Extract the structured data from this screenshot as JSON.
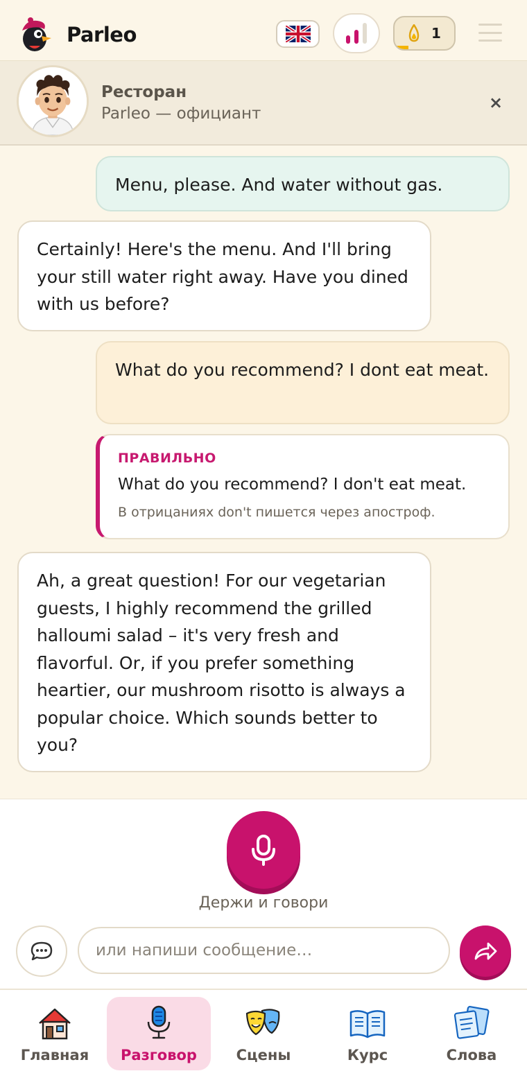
{
  "header": {
    "app_name": "Parleo",
    "language_flag": "uk-flag-icon",
    "coins": "1"
  },
  "scene": {
    "title": "Ресторан",
    "subtitle": "Parleo — официант",
    "close_label": "×"
  },
  "messages": {
    "user_1": "Menu, please. And water without gas.",
    "bot_1": "Certainly! Here's the menu. And I'll bring your still water right away. Have you dined with us before?",
    "user_2": "What do you recommend? I dont eat meat.",
    "correction": {
      "label": "ПРАВИЛЬНО",
      "text": "What do you recommend? I don't eat meat.",
      "note": "В отрицаниях don't пишется через апостроф."
    },
    "bot_2": "Ah, a great question! For our vegetarian guests, I highly recommend the grilled halloumi salad – it's very fresh and flavorful. Or, if you prefer something heartier, our mushroom risotto is always a popular choice. Which sounds better to you?"
  },
  "voice": {
    "hold_label": "Держи и говори",
    "input_placeholder": "или напиши сообщение…"
  },
  "nav": {
    "items": [
      {
        "label": "Главная",
        "icon": "house-icon"
      },
      {
        "label": "Разговор",
        "icon": "microphone-icon"
      },
      {
        "label": "Сцены",
        "icon": "theater-masks-icon"
      },
      {
        "label": "Курс",
        "icon": "book-icon"
      },
      {
        "label": "Слова",
        "icon": "flashcards-icon"
      }
    ],
    "active": "Разговор"
  },
  "colors": {
    "accent": "#c8126c",
    "background": "#fcf6e8",
    "user_bubble": "#e6f5ef",
    "user_bubble_error": "#fdf0d8"
  }
}
